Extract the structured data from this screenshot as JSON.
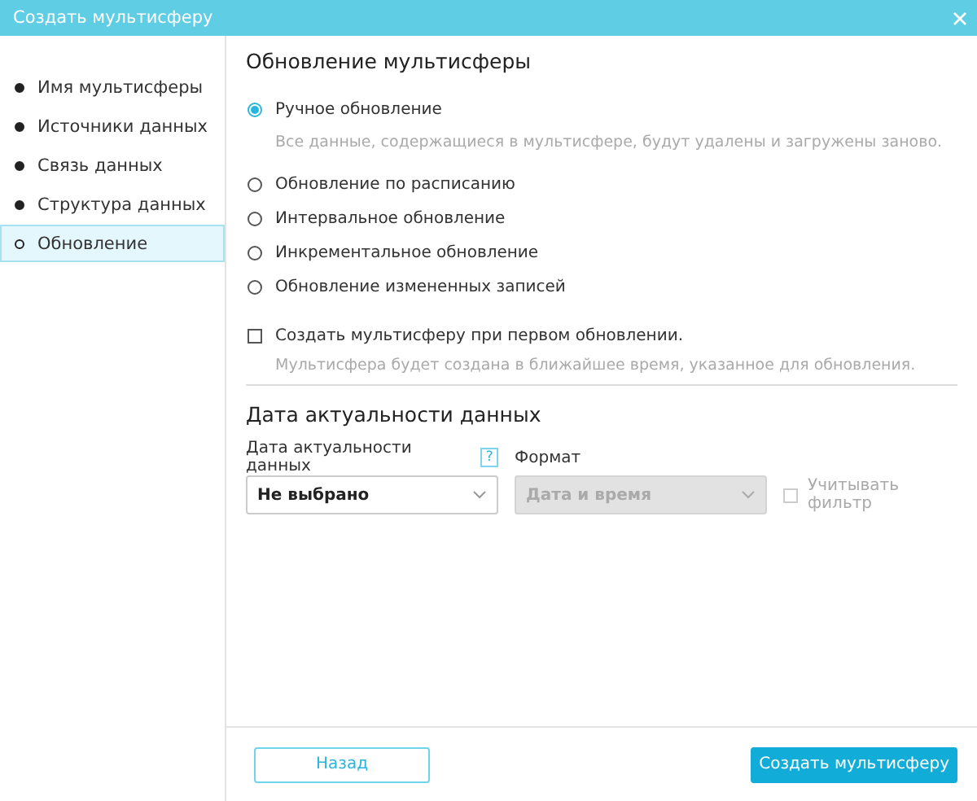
{
  "window": {
    "title": "Создать мультисферу"
  },
  "sidebar": {
    "items": [
      {
        "label": "Имя мультисферы",
        "done": true,
        "selected": false
      },
      {
        "label": "Источники данных",
        "done": true,
        "selected": false
      },
      {
        "label": "Связь данных",
        "done": true,
        "selected": false
      },
      {
        "label": "Структура данных",
        "done": true,
        "selected": false
      },
      {
        "label": "Обновление",
        "done": false,
        "selected": true
      }
    ]
  },
  "update_section": {
    "title": "Обновление мультисферы",
    "options": [
      {
        "label": "Ручное обновление",
        "selected": true,
        "hint": "Все данные, содержащиеся в мультисфере, будут удалены и загружены заново."
      },
      {
        "label": "Обновление по расписанию",
        "selected": false
      },
      {
        "label": "Интервальное обновление",
        "selected": false
      },
      {
        "label": "Инкрементальное обновление",
        "selected": false
      },
      {
        "label": "Обновление измененных записей",
        "selected": false
      }
    ],
    "create_on_first": {
      "label": "Создать мультисферу при первом обновлении.",
      "checked": false,
      "hint": "Мультисфера будет создана в ближайшее время, указанное для обновления."
    }
  },
  "date_section": {
    "title": "Дата актуальности данных",
    "date_field": {
      "label": "Дата актуальности данных",
      "help": "?",
      "value": "Не выбрано",
      "disabled": false
    },
    "format_field": {
      "label": "Формат",
      "value": "Дата и время",
      "disabled": true
    },
    "filter": {
      "label": "Учитывать фильтр",
      "checked": false,
      "disabled": true
    }
  },
  "buttons": {
    "back": "Назад",
    "create": "Создать мультисферу"
  }
}
